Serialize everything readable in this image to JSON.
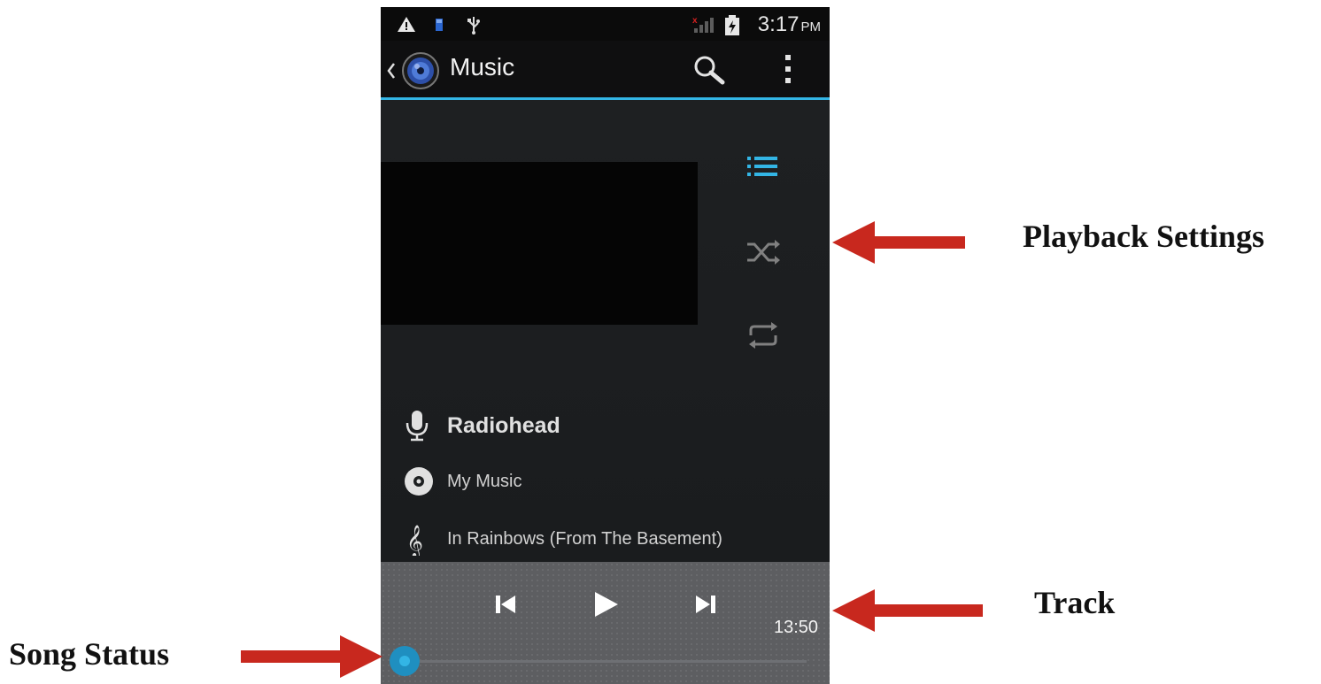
{
  "status_bar": {
    "icons": [
      "warning-icon",
      "sd-card-icon",
      "usb-icon",
      "no-signal-icon",
      "battery-icon"
    ],
    "time": "3:17",
    "ampm": "PM"
  },
  "action_bar": {
    "title": "Music",
    "accent_color": "#33b5e5"
  },
  "side_controls": [
    "playlist-icon",
    "shuffle-icon",
    "repeat-icon"
  ],
  "track_info": {
    "artist": "Radiohead",
    "album": "My Music",
    "song": "In Rainbows (From The Basement)"
  },
  "controls": {
    "duration": "13:50",
    "progress": 0
  },
  "annotations": {
    "playback_settings": "Playback Settings",
    "track": "Track",
    "song_status": "Song Status",
    "arrow_color": "#c8281e"
  }
}
